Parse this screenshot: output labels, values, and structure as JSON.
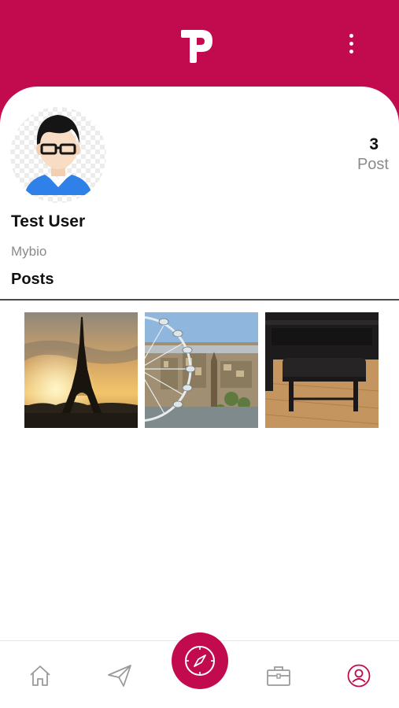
{
  "app": {
    "logo_icon": "tp-logo-icon",
    "brand_color": "#c20a4e",
    "menu_icon": "more-vertical-icon"
  },
  "profile": {
    "name": "Test User",
    "bio": "Mybio",
    "avatar_icon": "user-avatar-icon",
    "stats": {
      "post_count": "3",
      "post_label": "Post"
    }
  },
  "posts_section": {
    "title": "Posts",
    "items": [
      {
        "subject": "eiffel-tower-sunset"
      },
      {
        "subject": "london-eye-skyline"
      },
      {
        "subject": "piano-bench"
      }
    ]
  },
  "bottom_nav": {
    "items": [
      {
        "icon": "home-icon",
        "active": false
      },
      {
        "icon": "send-icon",
        "active": false
      },
      {
        "icon": "compass-icon",
        "active": false,
        "center": true
      },
      {
        "icon": "briefcase-icon",
        "active": false
      },
      {
        "icon": "profile-icon",
        "active": true
      }
    ],
    "active_color": "#c20a4e",
    "inactive_color": "#9a9a9a"
  }
}
